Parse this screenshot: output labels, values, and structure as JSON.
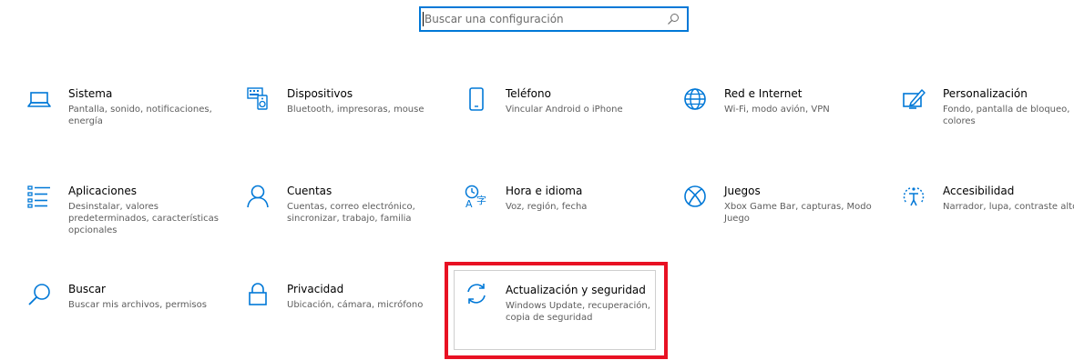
{
  "search": {
    "placeholder": "Buscar una configuración"
  },
  "categories": [
    {
      "id": "sistema",
      "icon": "laptop-icon",
      "label": "Sistema",
      "description": "Pantalla, sonido, notificaciones, energía"
    },
    {
      "id": "dispositivos",
      "icon": "keyboard-speaker-icon",
      "label": "Dispositivos",
      "description": "Bluetooth, impresoras, mouse"
    },
    {
      "id": "telefono",
      "icon": "phone-icon",
      "label": "Teléfono",
      "description": "Vincular Android o iPhone"
    },
    {
      "id": "red",
      "icon": "globe-icon",
      "label": "Red e Internet",
      "description": "Wi-Fi, modo avión, VPN"
    },
    {
      "id": "personalizacion",
      "icon": "paint-pen-icon",
      "label": "Personalización",
      "description": "Fondo, pantalla de bloqueo, colores"
    },
    {
      "id": "aplicaciones",
      "icon": "apps-list-icon",
      "label": "Aplicaciones",
      "description": "Desinstalar, valores predeterminados, características opcionales"
    },
    {
      "id": "cuentas",
      "icon": "person-icon",
      "label": "Cuentas",
      "description": "Cuentas, correo electrónico, sincronizar, trabajo, familia"
    },
    {
      "id": "hora",
      "icon": "time-language-icon",
      "label": "Hora e idioma",
      "description": "Voz, región, fecha"
    },
    {
      "id": "juegos",
      "icon": "xbox-icon",
      "label": "Juegos",
      "description": "Xbox Game Bar, capturas, Modo Juego"
    },
    {
      "id": "accesibilidad",
      "icon": "accessibility-icon",
      "label": "Accesibilidad",
      "description": "Narrador, lupa, contraste alto"
    },
    {
      "id": "buscar",
      "icon": "search-icon",
      "label": "Buscar",
      "description": "Buscar mis archivos, permisos"
    },
    {
      "id": "privacidad",
      "icon": "lock-icon",
      "label": "Privacidad",
      "description": "Ubicación, cámara, micrófono"
    },
    {
      "id": "actualizacion",
      "icon": "sync-icon",
      "label": "Actualización y seguridad",
      "description": "Windows Update, recuperación, copia de seguridad"
    }
  ],
  "colors": {
    "accent": "#0078d7",
    "highlight": "#e81123",
    "description_text": "#5d5d5d"
  }
}
